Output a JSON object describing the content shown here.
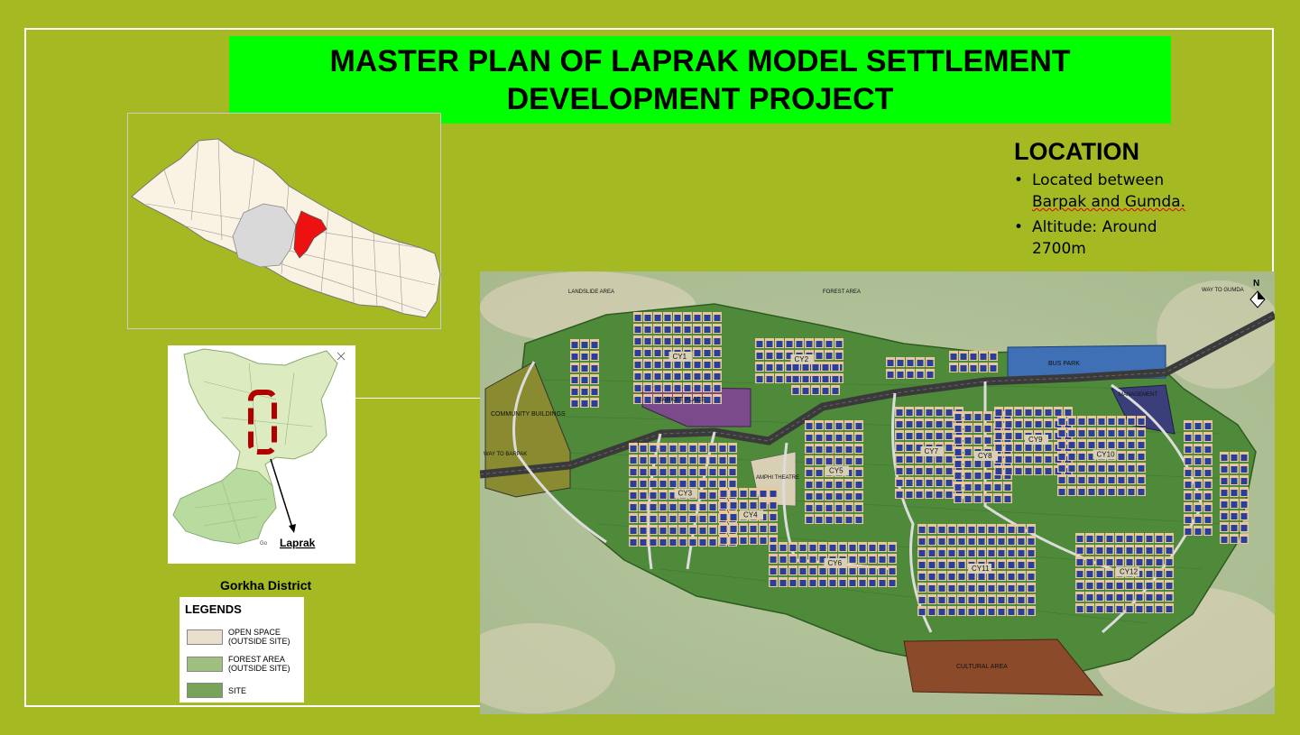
{
  "title": {
    "line1": "MASTER PLAN OF LAPRAK MODEL SETTLEMENT",
    "line2": "DEVELOPMENT PROJECT"
  },
  "location": {
    "heading": "LOCATION",
    "bullet1_a": "Located between ",
    "bullet1_b": "Barpak and Gumda.",
    "bullet2_a": "Altitude: Around ",
    "bullet2_b": "2700m"
  },
  "gorkha_map": {
    "caption": "Gorkha District",
    "place_label": "Laprak",
    "partial_label": "Go"
  },
  "legend": {
    "title": "LEGENDS",
    "items": [
      {
        "label_1": "OPEN SPACE",
        "label_2": "(OUTSIDE SITE)",
        "color": "#e8e0cc"
      },
      {
        "label_1": "FOREST AREA",
        "label_2": "(OUTSIDE SITE)",
        "color": "#9fbf7e"
      },
      {
        "label_1": "SITE",
        "label_2": "",
        "color": "#77a25a"
      }
    ]
  },
  "site_plan": {
    "labels": {
      "way_to_barpak": "WAY TO BARPAK",
      "way_to_gumda": "WAY TO GUMDA",
      "north": "N",
      "landslide": "LANDSLIDE AREA",
      "forest": "FOREST AREA",
      "bus_park": "BUS PARK",
      "market": "MARKET PLACE",
      "community": "COMMUNITY BUILDINGS",
      "amphi": "AMPHI THEATRE",
      "cultural": "CULTURAL AREA",
      "management": "MANAGEMENT",
      "cy1": "CY1",
      "cy2": "CY2",
      "cy3": "CY3",
      "cy4": "CY4",
      "cy5": "CY5",
      "cy6": "CY6",
      "cy7": "CY7",
      "cy8": "CY8",
      "cy9": "CY9",
      "cy10": "CY10",
      "cy11": "CY11",
      "cy12": "CY12"
    },
    "colors": {
      "site": "#4f8a3a",
      "road": "#3a3a3a",
      "roof": "#2a3f9a",
      "plot": "#e8c89a",
      "cultural": "#8b4a2a",
      "bus_park": "#3f6fb5",
      "market": "#7a4a8a",
      "community": "#8a8a30"
    }
  }
}
